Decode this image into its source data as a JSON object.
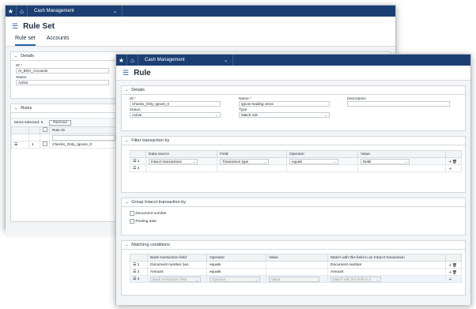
{
  "topbar": {
    "module": "Cash Management"
  },
  "back_window": {
    "title": "Rule Set",
    "tabs": [
      "Rule set",
      "Accounts"
    ],
    "details": {
      "header": "Details",
      "id_label": "ID",
      "id_value": "AI_BOA_Accounts",
      "status_label": "Status",
      "status_value": "Active"
    },
    "rules": {
      "header": "Rules",
      "items_selected": "Items selected: 0",
      "remove_label": "Remove",
      "col_rule_id": "Rule ID",
      "row_num": "1",
      "row_rule": "Checks_Only_Ignore_0"
    }
  },
  "front_window": {
    "title": "Rule",
    "details": {
      "header": "Details",
      "id_label": "ID",
      "id_value": "Checks_Only_Ignore_0",
      "name_label": "Name",
      "name_value": "Ignore leading zeros",
      "description_label": "Description",
      "status_label": "Status",
      "status_value": "Active",
      "type_label": "Type",
      "type_value": "Match rule"
    },
    "filter": {
      "header": "Filter transaction by",
      "columns": [
        "Data source",
        "Field",
        "Operator",
        "Value"
      ],
      "rows": [
        {
          "num": "1",
          "source": "Intacct transactions",
          "field": "Transaction type",
          "operator": "equals",
          "value": "Debit"
        },
        {
          "num": "2",
          "source": "",
          "field": "",
          "operator": "",
          "value": ""
        }
      ]
    },
    "group": {
      "header": "Group Intacct transaction by",
      "options": [
        "Document number",
        "Posting date"
      ]
    },
    "matching": {
      "header": "Matching conditions",
      "columns": [
        "Bank transaction field",
        "Operator",
        "Value",
        "Match with this field in an Intacct transaction"
      ],
      "rows": [
        {
          "num": "1",
          "field": "Document number (wo",
          "operator": "equals",
          "value": "",
          "match": "Document number"
        },
        {
          "num": "2",
          "field": "Amount",
          "operator": "equals",
          "value": "",
          "match": "Amount"
        },
        {
          "num": "3",
          "field": "Bank transaction field",
          "operator": "Operator",
          "value": "Value",
          "match": "Match with this field in a"
        }
      ]
    }
  }
}
